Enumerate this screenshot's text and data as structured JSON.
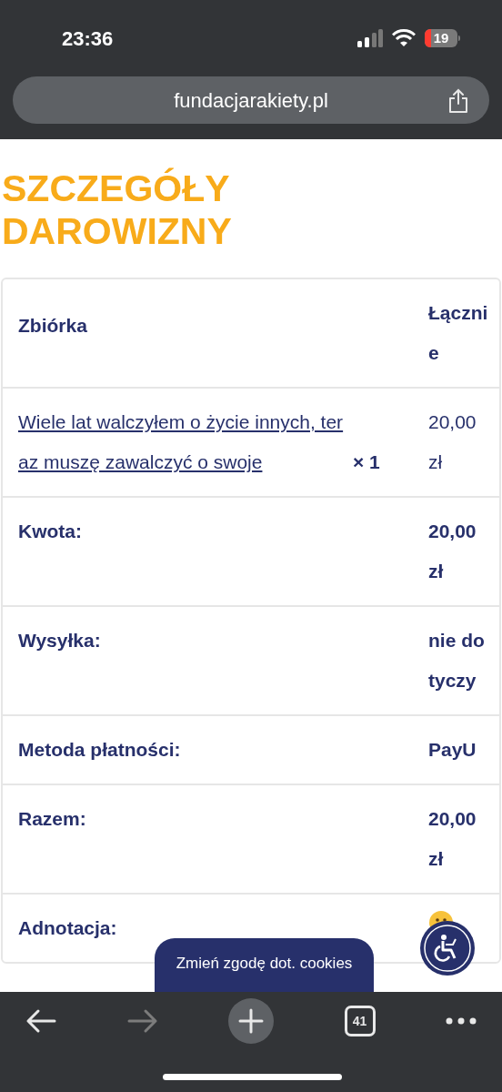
{
  "status_bar": {
    "time": "23:36",
    "battery": "19"
  },
  "address_bar": {
    "url": "fundacjarakiety.pl"
  },
  "page": {
    "title": "SZCZEGÓŁY DAROWIZNY",
    "table": {
      "columns": [
        "Zbiórka",
        "Łącznie"
      ],
      "item": {
        "link": "Wiele lat walczyłem o życie innych, teraz muszę zawalczyć o swoje",
        "quantity": "× 1",
        "total": "20,00 zł"
      },
      "rows": [
        {
          "label": "Kwota:",
          "value": "20,00 zł",
          "kind": "text"
        },
        {
          "label": "Wysyłka:",
          "value": "nie dotyczy",
          "kind": "text"
        },
        {
          "label": "Metoda płatności:",
          "value": "PayU",
          "kind": "text"
        },
        {
          "label": "Razem:",
          "value": "20,00 zł",
          "kind": "text"
        },
        {
          "label": "Adnotacja:",
          "kind": "smiley"
        }
      ]
    },
    "cookie_button": "Zmień zgodę dot. cookies"
  },
  "toolbar": {
    "tabs_count": "41"
  }
}
